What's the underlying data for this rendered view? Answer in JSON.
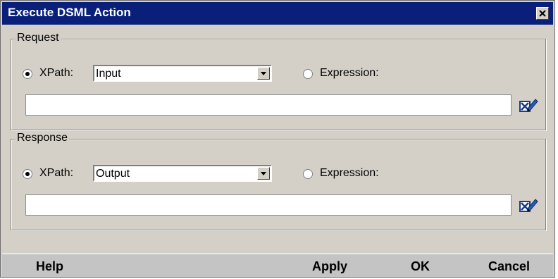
{
  "window": {
    "title": "Execute DSML Action"
  },
  "request": {
    "legend": "Request",
    "xpath_label": "XPath:",
    "xpath_selected": true,
    "xpath_value": "Input",
    "expression_label": "Expression:",
    "expression_selected": false,
    "expression_text": ""
  },
  "response": {
    "legend": "Response",
    "xpath_label": "XPath:",
    "xpath_selected": true,
    "xpath_value": "Output",
    "expression_label": "Expression:",
    "expression_selected": false,
    "expression_text": ""
  },
  "buttons": {
    "help": "Help",
    "apply": "Apply",
    "ok": "OK",
    "cancel": "Cancel"
  },
  "icons": {
    "close": "close-icon",
    "dropdown": "chevron-down-icon",
    "editor": "expression-editor-icon"
  },
  "colors": {
    "titlebar": "#0a1f7a",
    "dialog_bg": "#d4d0c8",
    "button_bar": "#c4c4c4"
  }
}
